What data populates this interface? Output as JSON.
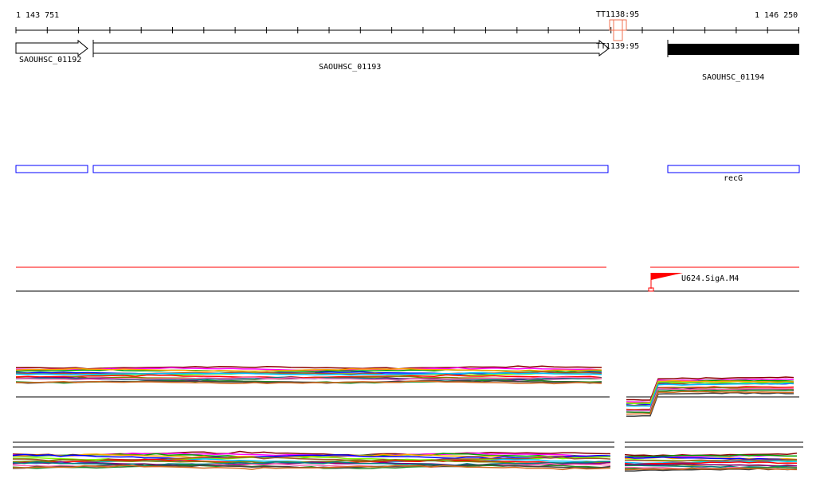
{
  "ruler": {
    "start_label": "1 143 751",
    "end_label": "1 146 250"
  },
  "terminators": [
    {
      "label": "TT1138:95",
      "color": "#f07050"
    },
    {
      "label": "TT1139:95",
      "color": "#f07050"
    }
  ],
  "genes": [
    {
      "name": "SAOUHSC_01192",
      "strand": "+"
    },
    {
      "name": "SAOUHSC_01193",
      "strand": "+"
    },
    {
      "name": "SAOUHSC_01194",
      "strand": "-"
    }
  ],
  "annotation_track": {
    "color": "#0000ff",
    "labels": [
      "recG"
    ]
  },
  "promoter_track": {
    "line_color": "#ff0000",
    "promoter_label": "U624.SigA.M4"
  },
  "expression_colors": [
    "#8b0000",
    "#ff00ff",
    "#00a000",
    "#ffa500",
    "#0000ff",
    "#7fff00",
    "#a0522d",
    "#00bfff",
    "#ff0000",
    "#808000",
    "#800080",
    "#008080",
    "#ff69b4",
    "#228b22",
    "#444444",
    "#d2691e"
  ]
}
